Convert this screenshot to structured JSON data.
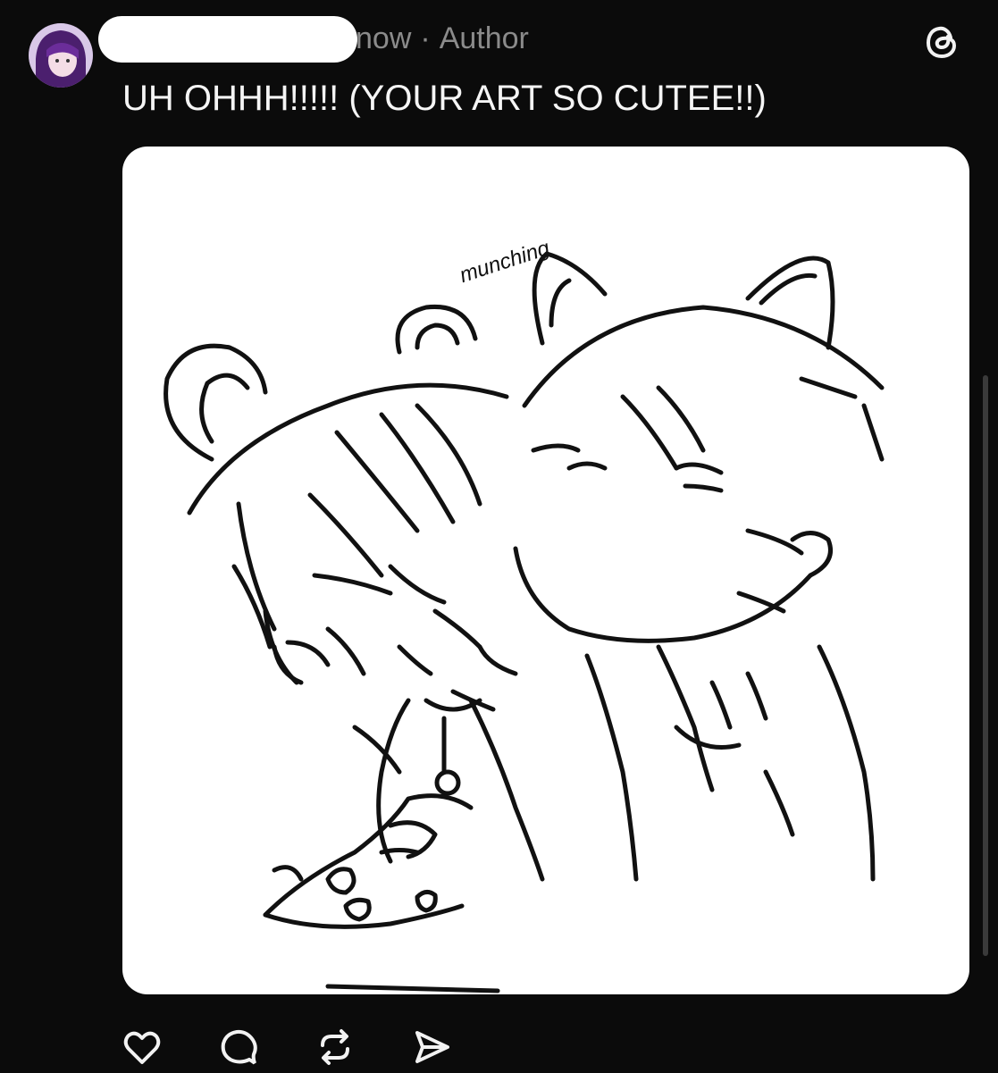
{
  "post": {
    "timestamp": "now",
    "separator": "·",
    "role_badge": "Author",
    "text": "UH OHHH!!!!! (YOUR ART SO CUTEE!!)"
  },
  "artwork": {
    "caption": "munching"
  },
  "icons": {
    "avatar": "avatar-image",
    "app": "threads-logo-icon",
    "actions": [
      "heart-icon",
      "comment-icon",
      "repost-icon",
      "share-icon"
    ]
  },
  "colors": {
    "background": "#0b0b0b",
    "text": "#f5f5f5",
    "muted": "#8b8b8b",
    "card": "#ffffff"
  }
}
